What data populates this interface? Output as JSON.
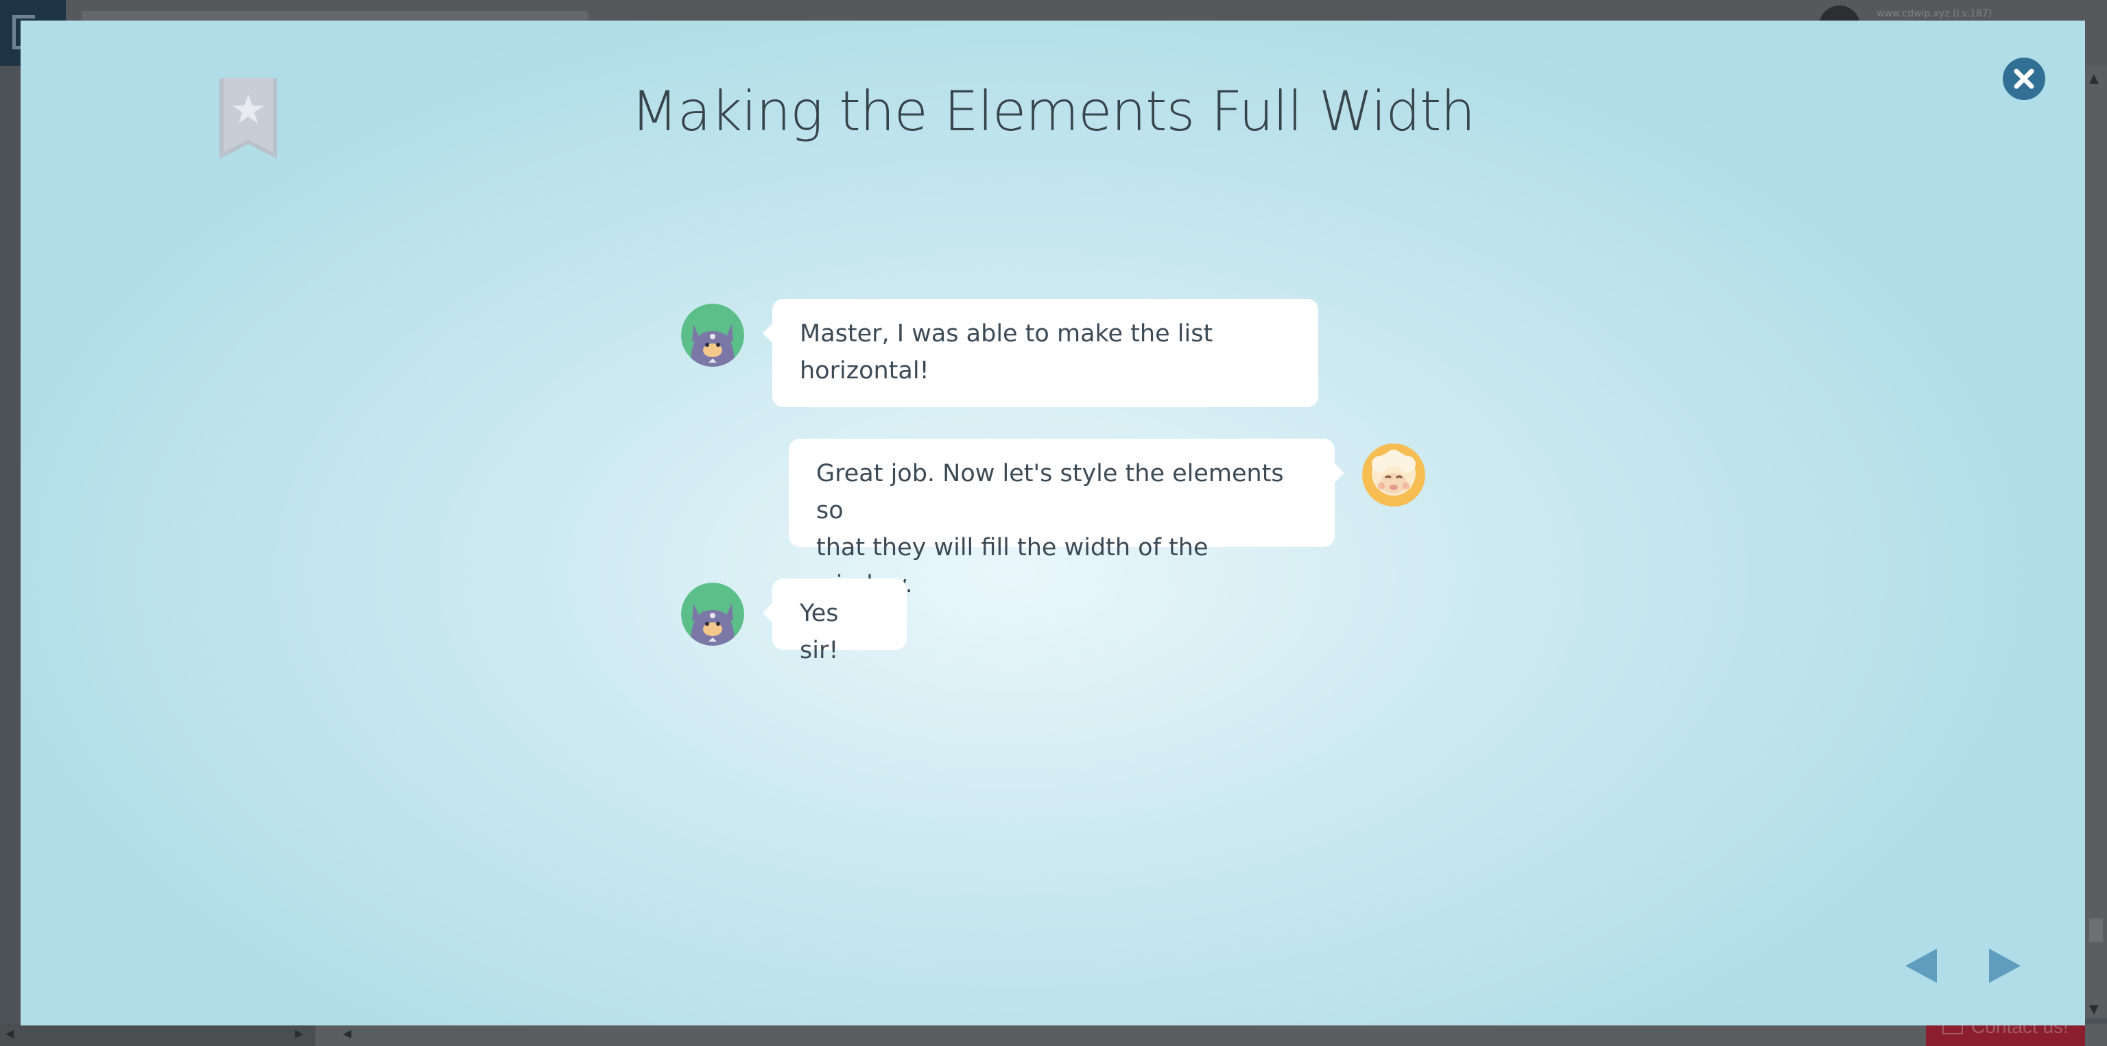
{
  "background_app": {
    "user_label": "www.cdwip.xyz (Lv.187)",
    "contact_label": "Contact us!"
  },
  "modal": {
    "title": "Making the Elements Full Width"
  },
  "messages": [
    {
      "speaker": "student",
      "side": "left",
      "lines": [
        "Master, I was able to make the list",
        "horizontal!"
      ]
    },
    {
      "speaker": "master",
      "side": "right",
      "lines": [
        "Great job. Now let's style the elements so",
        "that they will fill the width of the window."
      ]
    },
    {
      "speaker": "student",
      "side": "left",
      "lines": [
        "Yes sir!"
      ]
    }
  ],
  "colors": {
    "modal_gradient_center": "#eaf7fb",
    "modal_gradient_edge": "#b0dde7",
    "close_button": "#316f95",
    "nav_arrows": "#5f9dbf",
    "bookmark": "#bfc6cf",
    "student_avatar_bg": "#5cbf8a",
    "master_avatar_bg": "#f6bd52"
  },
  "icons": {
    "bookmark": "bookmark-star-icon",
    "close": "close-x-icon",
    "prev": "triangle-left-icon",
    "next": "triangle-right-icon"
  }
}
